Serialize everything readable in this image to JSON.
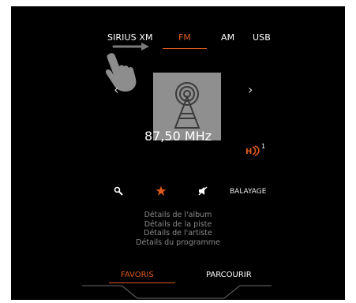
{
  "source_tabs": [
    {
      "label": "SIRIUS XM",
      "active": false
    },
    {
      "label": "FM",
      "active": true
    },
    {
      "label": "AM",
      "active": false
    },
    {
      "label": "USB",
      "active": false
    }
  ],
  "station": {
    "frequency": "87,50 MHz",
    "hd_channel": "1",
    "art_icon": "radio-tower-icon"
  },
  "nav": {
    "prev_icon": "chevron-left-icon",
    "next_icon": "chevron-right-icon"
  },
  "controls": {
    "search_icon": "search-icon",
    "favorite_icon": "star-icon",
    "traffic_icon": "traffic-announcement-off-icon",
    "scan_label": "BALAYAGE"
  },
  "details": [
    "Détails de l'album",
    "Détails de la piste",
    "Détails de l'artiste",
    "Détails du programme"
  ],
  "bottom_tabs": [
    {
      "label": "FAVORIS",
      "active": true
    },
    {
      "label": "PARCOURIR",
      "active": false
    }
  ],
  "colors": {
    "accent": "#e05a1e",
    "background": "#000000",
    "text": "#ffffff",
    "muted_text": "#8a8a8a",
    "art_background": "#8f8f8f"
  },
  "gesture_hint": {
    "arrow_icon": "swipe-right-arrow-icon",
    "hand_icon": "hand-pointer-icon"
  }
}
